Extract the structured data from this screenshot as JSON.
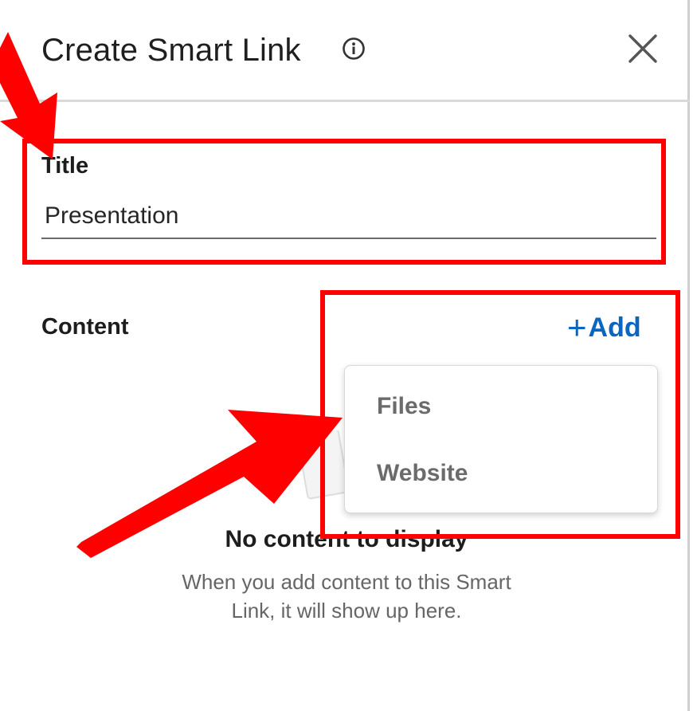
{
  "header": {
    "title": "Create Smart Link",
    "info_icon": "info-circle-icon",
    "close_icon": "close-x-icon"
  },
  "form": {
    "title_label": "Title",
    "title_value": "Presentation",
    "content_label": "Content",
    "add_label": "Add",
    "add_plus": "+"
  },
  "dropdown": {
    "items": [
      {
        "label": "Files"
      },
      {
        "label": "Website"
      }
    ]
  },
  "empty_state": {
    "title": "No content to display",
    "description": "When you add content to this Smart Link, it will show up here."
  },
  "colors": {
    "accent": "#0a66c2",
    "annotation": "#ff0000"
  }
}
